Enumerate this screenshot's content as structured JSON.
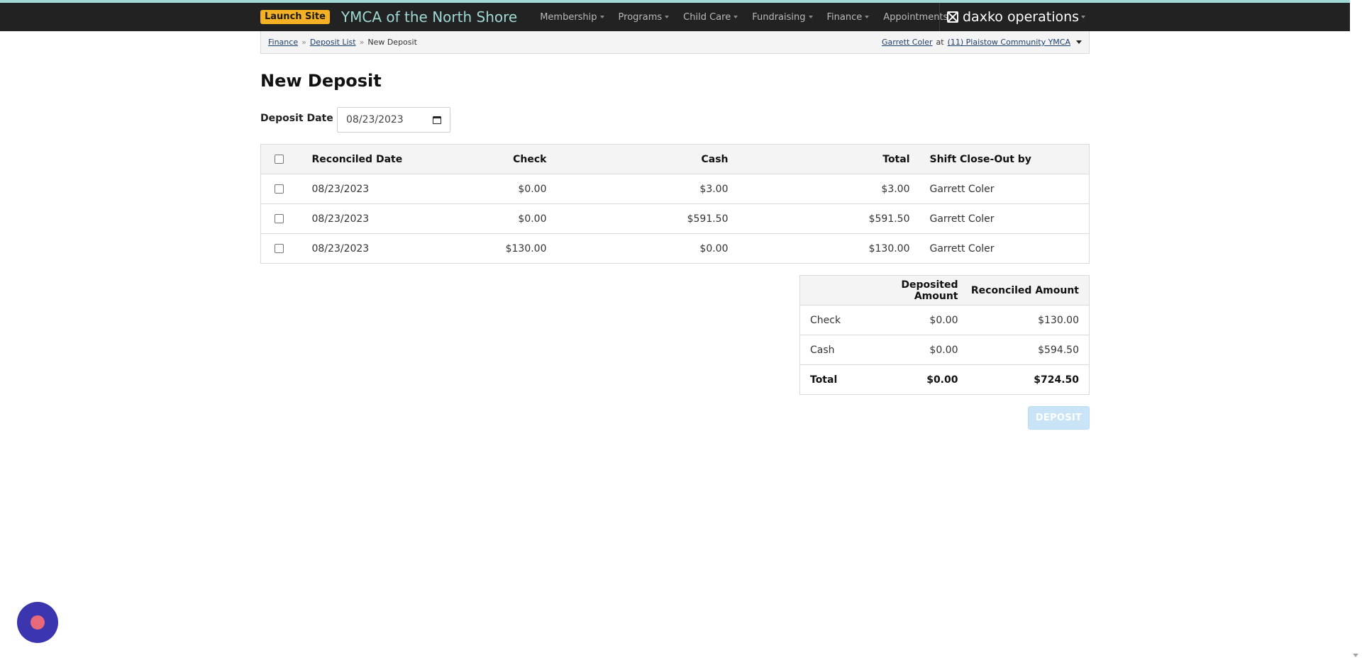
{
  "navbar": {
    "launch_label": "Launch Site",
    "org_title": "YMCA of the North Shore",
    "menu": [
      {
        "label": "Membership"
      },
      {
        "label": "Programs"
      },
      {
        "label": "Child Care"
      },
      {
        "label": "Fundraising"
      },
      {
        "label": "Finance"
      },
      {
        "label": "Appointments"
      }
    ],
    "product": "daxko operations",
    "colors": {
      "bar": "#222222",
      "accent": "#9fd8d5",
      "launch": "#f5b125"
    }
  },
  "breadcrumb": {
    "items": [
      "Finance",
      "Deposit List"
    ],
    "current": "New Deposit",
    "separator": "»"
  },
  "user": {
    "name": "Garrett Coler",
    "at": "at",
    "location": "(11) Plaistow Community YMCA"
  },
  "page": {
    "title": "New Deposit",
    "deposit_date_label": "Deposit Date",
    "deposit_date_value": "08/23/2023"
  },
  "shifts_table": {
    "headers": [
      "Reconciled Date",
      "Check",
      "Cash",
      "Total",
      "Shift Close-Out by"
    ],
    "rows": [
      {
        "date": "08/23/2023",
        "check": "$0.00",
        "cash": "$3.00",
        "total": "$3.00",
        "by": "Garrett Coler"
      },
      {
        "date": "08/23/2023",
        "check": "$0.00",
        "cash": "$591.50",
        "total": "$591.50",
        "by": "Garrett Coler"
      },
      {
        "date": "08/23/2023",
        "check": "$130.00",
        "cash": "$0.00",
        "total": "$130.00",
        "by": "Garrett Coler"
      }
    ]
  },
  "summary_table": {
    "headers": [
      "",
      "Deposited Amount",
      "Reconciled Amount"
    ],
    "rows": [
      {
        "label": "Check",
        "deposited": "$0.00",
        "reconciled": "$130.00"
      },
      {
        "label": "Cash",
        "deposited": "$0.00",
        "reconciled": "$594.50"
      },
      {
        "label": "Total",
        "deposited": "$0.00",
        "reconciled": "$724.50"
      }
    ]
  },
  "actions": {
    "deposit_label": "DEPOSIT",
    "deposit_disabled_color": "#c8e4f6"
  },
  "chat": {
    "icon": "chat-launcher-icon",
    "color": "#3b35b0"
  }
}
